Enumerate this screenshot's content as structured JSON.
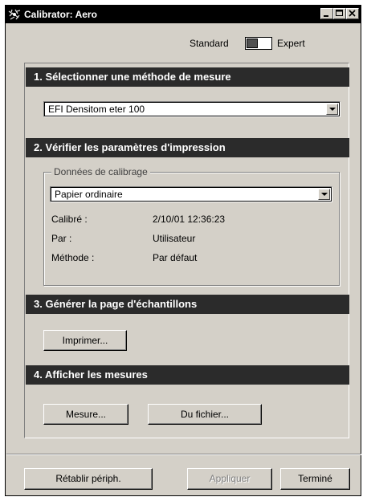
{
  "window": {
    "title": "Calibrator: Aero"
  },
  "mode": {
    "standard_label": "Standard",
    "expert_label": "Expert"
  },
  "sections": {
    "s1": {
      "title": "1. Sélectionner une méthode de mesure",
      "instrument_select": "EFI Densitom eter 100"
    },
    "s2": {
      "title": "2. Vérifier les paramètres d'impression",
      "group_label": "Données de calibrage",
      "paper_select": "Papier ordinaire",
      "info": [
        {
          "label": "Calibré :",
          "value": "2/10/01 12:36:23"
        },
        {
          "label": "Par :",
          "value": "Utilisateur"
        },
        {
          "label": "Méthode :",
          "value": "Par défaut"
        }
      ]
    },
    "s3": {
      "title": "3. Générer la page d'échantillons",
      "print_button": "Imprimer..."
    },
    "s4": {
      "title": "4. Afficher les mesures",
      "measure_button": "Mesure...",
      "file_button": "Du fichier..."
    }
  },
  "footer": {
    "reset_button": "Rétablir périph.",
    "apply_button": "Appliquer",
    "done_button": "Terminé"
  }
}
